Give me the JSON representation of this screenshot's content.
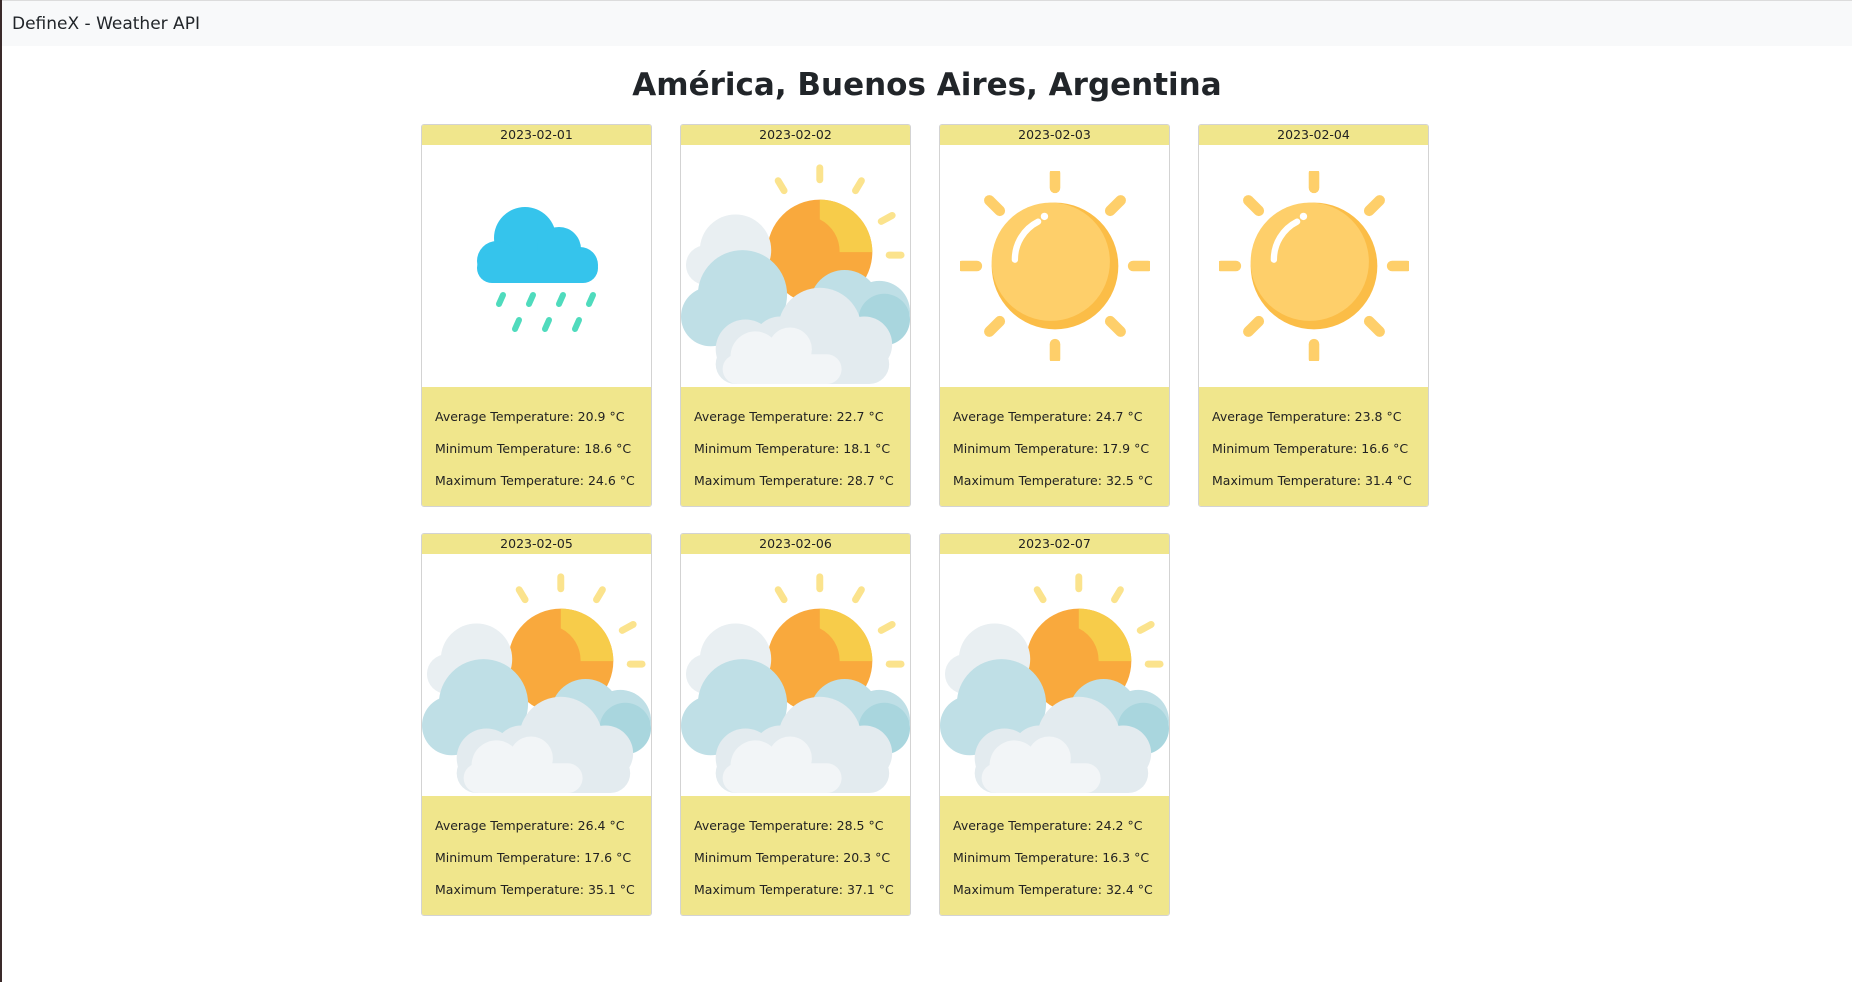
{
  "navbar": {
    "brand": "DefineX - Weather API"
  },
  "page": {
    "title": "América, Buenos Aires, Argentina"
  },
  "labels": {
    "avg": "Average Temperature: ",
    "min": "Minimum Temperature: ",
    "max": "Maximum Temperature: "
  },
  "colors": {
    "card_accent": "#f0e68c",
    "rain_cloud": "#35c4ec",
    "rain_drops": "#4fdbbd",
    "sun": "#fecf6a",
    "sun_shade": "#fbbd47"
  },
  "days": [
    {
      "date": "2023-02-01",
      "icon": "rain-icon",
      "avg": "20.9 °C",
      "min": "18.6 °C",
      "max": "24.6 °C"
    },
    {
      "date": "2023-02-02",
      "icon": "partly-cloudy-icon",
      "avg": "22.7 °C",
      "min": "18.1 °C",
      "max": "28.7 °C"
    },
    {
      "date": "2023-02-03",
      "icon": "sun-icon",
      "avg": "24.7 °C",
      "min": "17.9 °C",
      "max": "32.5 °C"
    },
    {
      "date": "2023-02-04",
      "icon": "sun-icon",
      "avg": "23.8 °C",
      "min": "16.6 °C",
      "max": "31.4 °C"
    },
    {
      "date": "2023-02-05",
      "icon": "partly-cloudy-icon",
      "avg": "26.4 °C",
      "min": "17.6 °C",
      "max": "35.1 °C"
    },
    {
      "date": "2023-02-06",
      "icon": "partly-cloudy-icon",
      "avg": "28.5 °C",
      "min": "20.3 °C",
      "max": "37.1 °C"
    },
    {
      "date": "2023-02-07",
      "icon": "partly-cloudy-icon",
      "avg": "24.2 °C",
      "min": "16.3 °C",
      "max": "32.4 °C"
    }
  ]
}
